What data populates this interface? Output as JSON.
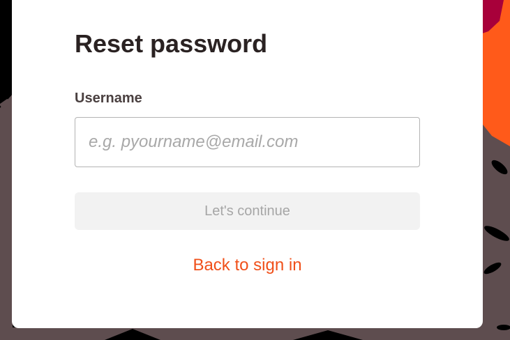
{
  "page": {
    "title": "Reset password"
  },
  "form": {
    "username_label": "Username",
    "username_value": "",
    "username_placeholder": "e.g. pyourname@email.com",
    "continue_label": "Let's continue",
    "continue_enabled": false
  },
  "links": {
    "back_to_sign_in": "Back to sign in"
  },
  "colors": {
    "accent": "#f0501a",
    "background_dark": "#000000",
    "background_taupe": "#5e4d4f",
    "background_orange": "#ff5a1a",
    "background_crimson": "#a8003a"
  }
}
